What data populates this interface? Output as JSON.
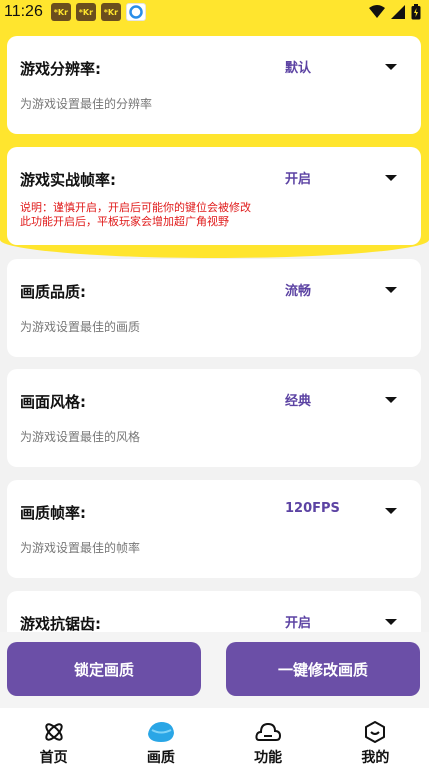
{
  "status_bar": {
    "time": "11:26",
    "noti_labels": [
      "*Kr",
      "*Kr",
      "*Kr"
    ]
  },
  "settings": [
    {
      "title": "游戏分辨率:",
      "value": "默认",
      "desc": "为游戏设置最佳的分辨率"
    },
    {
      "title": "游戏实战帧率:",
      "value": "开启",
      "note_line1": "说明：谨慎开启，开启后可能你的键位会被修改",
      "note_line2": "此功能开启后，平板玩家会增加超广角视野"
    },
    {
      "title": "画质品质:",
      "value": "流畅",
      "desc": "为游戏设置最佳的画质"
    },
    {
      "title": "画面风格:",
      "value": "经典",
      "desc": "为游戏设置最佳的风格"
    },
    {
      "title": "画质帧率:",
      "value": "120FPS",
      "desc": "为游戏设置最佳的帧率"
    },
    {
      "title": "游戏抗锯齿:",
      "value": "开启"
    }
  ],
  "buttons": {
    "lock": "锁定画质",
    "apply": "一键修改画质"
  },
  "tabs": [
    {
      "label": "首页",
      "icon": "atom-icon"
    },
    {
      "label": "画质",
      "icon": "blob-icon"
    },
    {
      "label": "功能",
      "icon": "cloud-icon"
    },
    {
      "label": "我的",
      "icon": "smile-box-icon"
    }
  ],
  "colors": {
    "accent": "#6b4fa7",
    "yellow": "#ffe52e",
    "note_red": "#e01a1a"
  }
}
